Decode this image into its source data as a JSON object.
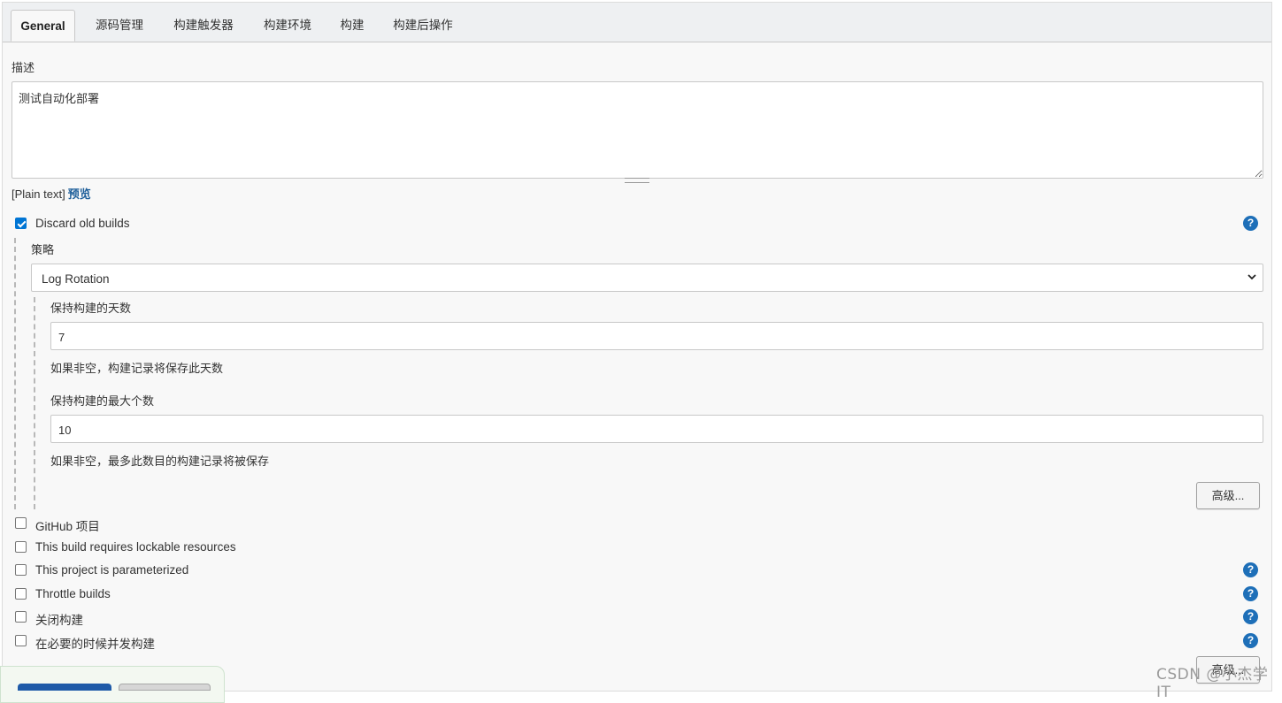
{
  "tabs": [
    {
      "label": "General",
      "active": true
    },
    {
      "label": "源码管理"
    },
    {
      "label": "构建触发器"
    },
    {
      "label": "构建环境"
    },
    {
      "label": "构建"
    },
    {
      "label": "构建后操作"
    }
  ],
  "description": {
    "label": "描述",
    "value": "测试自动化部署",
    "format_text": "[Plain text]",
    "preview_link": "预览"
  },
  "discard_old_builds": {
    "label": "Discard old builds",
    "checked": true,
    "strategy_label": "策略",
    "strategy_value": "Log Rotation",
    "days_label": "保持构建的天数",
    "days_value": "7",
    "days_hint": "如果非空，构建记录将保存此天数",
    "max_label": "保持构建的最大个数",
    "max_value": "10",
    "max_hint": "如果非空，最多此数目的构建记录将被保存",
    "advanced_button": "高级..."
  },
  "options": [
    {
      "label": "GitHub 项目",
      "checked": false
    },
    {
      "label": "This build requires lockable resources",
      "checked": false
    },
    {
      "label": "This project is parameterized",
      "checked": false
    },
    {
      "label": "Throttle builds",
      "checked": false
    },
    {
      "label": "关闭构建",
      "checked": false
    },
    {
      "label": "在必要的时候并发构建",
      "checked": false
    }
  ],
  "help_glyph": "?",
  "bottom_advanced_button": "高级...",
  "watermark": "CSDN @小杰学IT",
  "colors": {
    "link": "#1f5f9a",
    "help_icon": "#1e6fb8",
    "checkbox_checked": "#0075d4",
    "save_button": "#1e5aa8"
  }
}
